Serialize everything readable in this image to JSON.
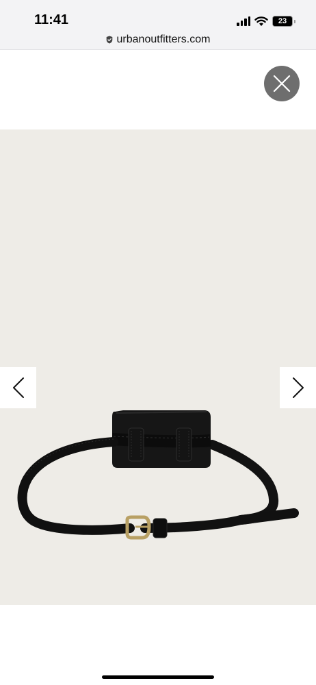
{
  "status_bar": {
    "time": "11:41",
    "battery_level": "23",
    "battery_fraction": 0.23,
    "icons": [
      "cellular-signal-icon",
      "wifi-icon",
      "battery-icon"
    ]
  },
  "browser": {
    "url": "urbanoutfitters.com",
    "security_icon": "shield-icon"
  },
  "gallery": {
    "close_icon": "close-icon",
    "prev_icon": "chevron-left-icon",
    "next_icon": "chevron-right-icon",
    "image_subject": "black leather belt bag",
    "background_color": "#eeece7"
  },
  "colors": {
    "close_button_bg": "#6e6e6e",
    "chrome_bg": "#f3f3f5",
    "buckle": "#b8a064"
  }
}
